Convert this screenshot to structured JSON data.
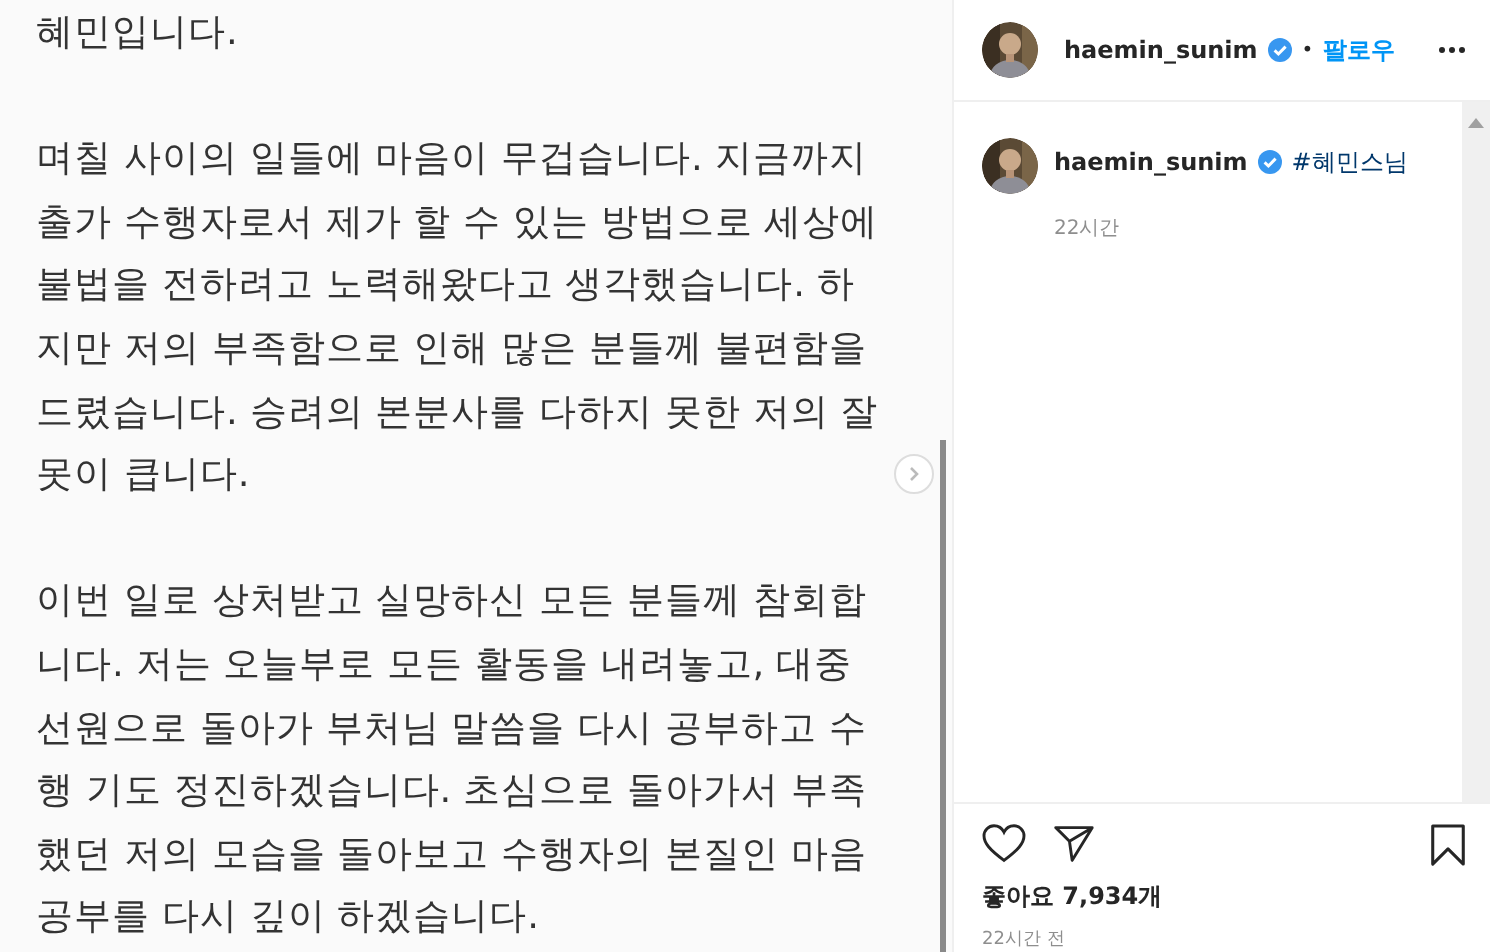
{
  "post_image": {
    "kind": "document",
    "paragraphs": [
      {
        "lines": [
          "혜민입니다."
        ]
      },
      {
        "lines": [
          "며칠 사이의 일들에 마음이 무겁습니다. 지금까지",
          "출가 수행자로서 제가 할 수 있는 방법으로 세상에",
          "불법을 전하려고 노력해왔다고 생각했습니다. 하",
          "지만 저의 부족함으로 인해 많은 분들께 불편함을",
          "드렸습니다. 승려의 본분사를 다하지 못한 저의 잘",
          "못이 큽니다."
        ]
      },
      {
        "lines": [
          "이번 일로 상처받고 실망하신 모든 분들께 참회합",
          "니다. 저는 오늘부로 모든 활동을 내려놓고, 대중",
          "선원으로 돌아가 부처님 말씀을 다시 공부하고 수",
          "행 기도 정진하겠습니다. 초심으로 돌아가서 부족",
          "했던 저의 모습을 돌아보고 수행자의 본질인 마음",
          "공부를 다시 깊이 하겠습니다."
        ]
      }
    ]
  },
  "header": {
    "username": "haemin_sunim",
    "verified": true,
    "separator": "•",
    "follow": "팔로우"
  },
  "caption": {
    "username": "haemin_sunim",
    "verified": true,
    "text": "#혜민스님",
    "time": "22시간"
  },
  "likes": "좋아요 7,934개",
  "timestamp": "22시간 전"
}
